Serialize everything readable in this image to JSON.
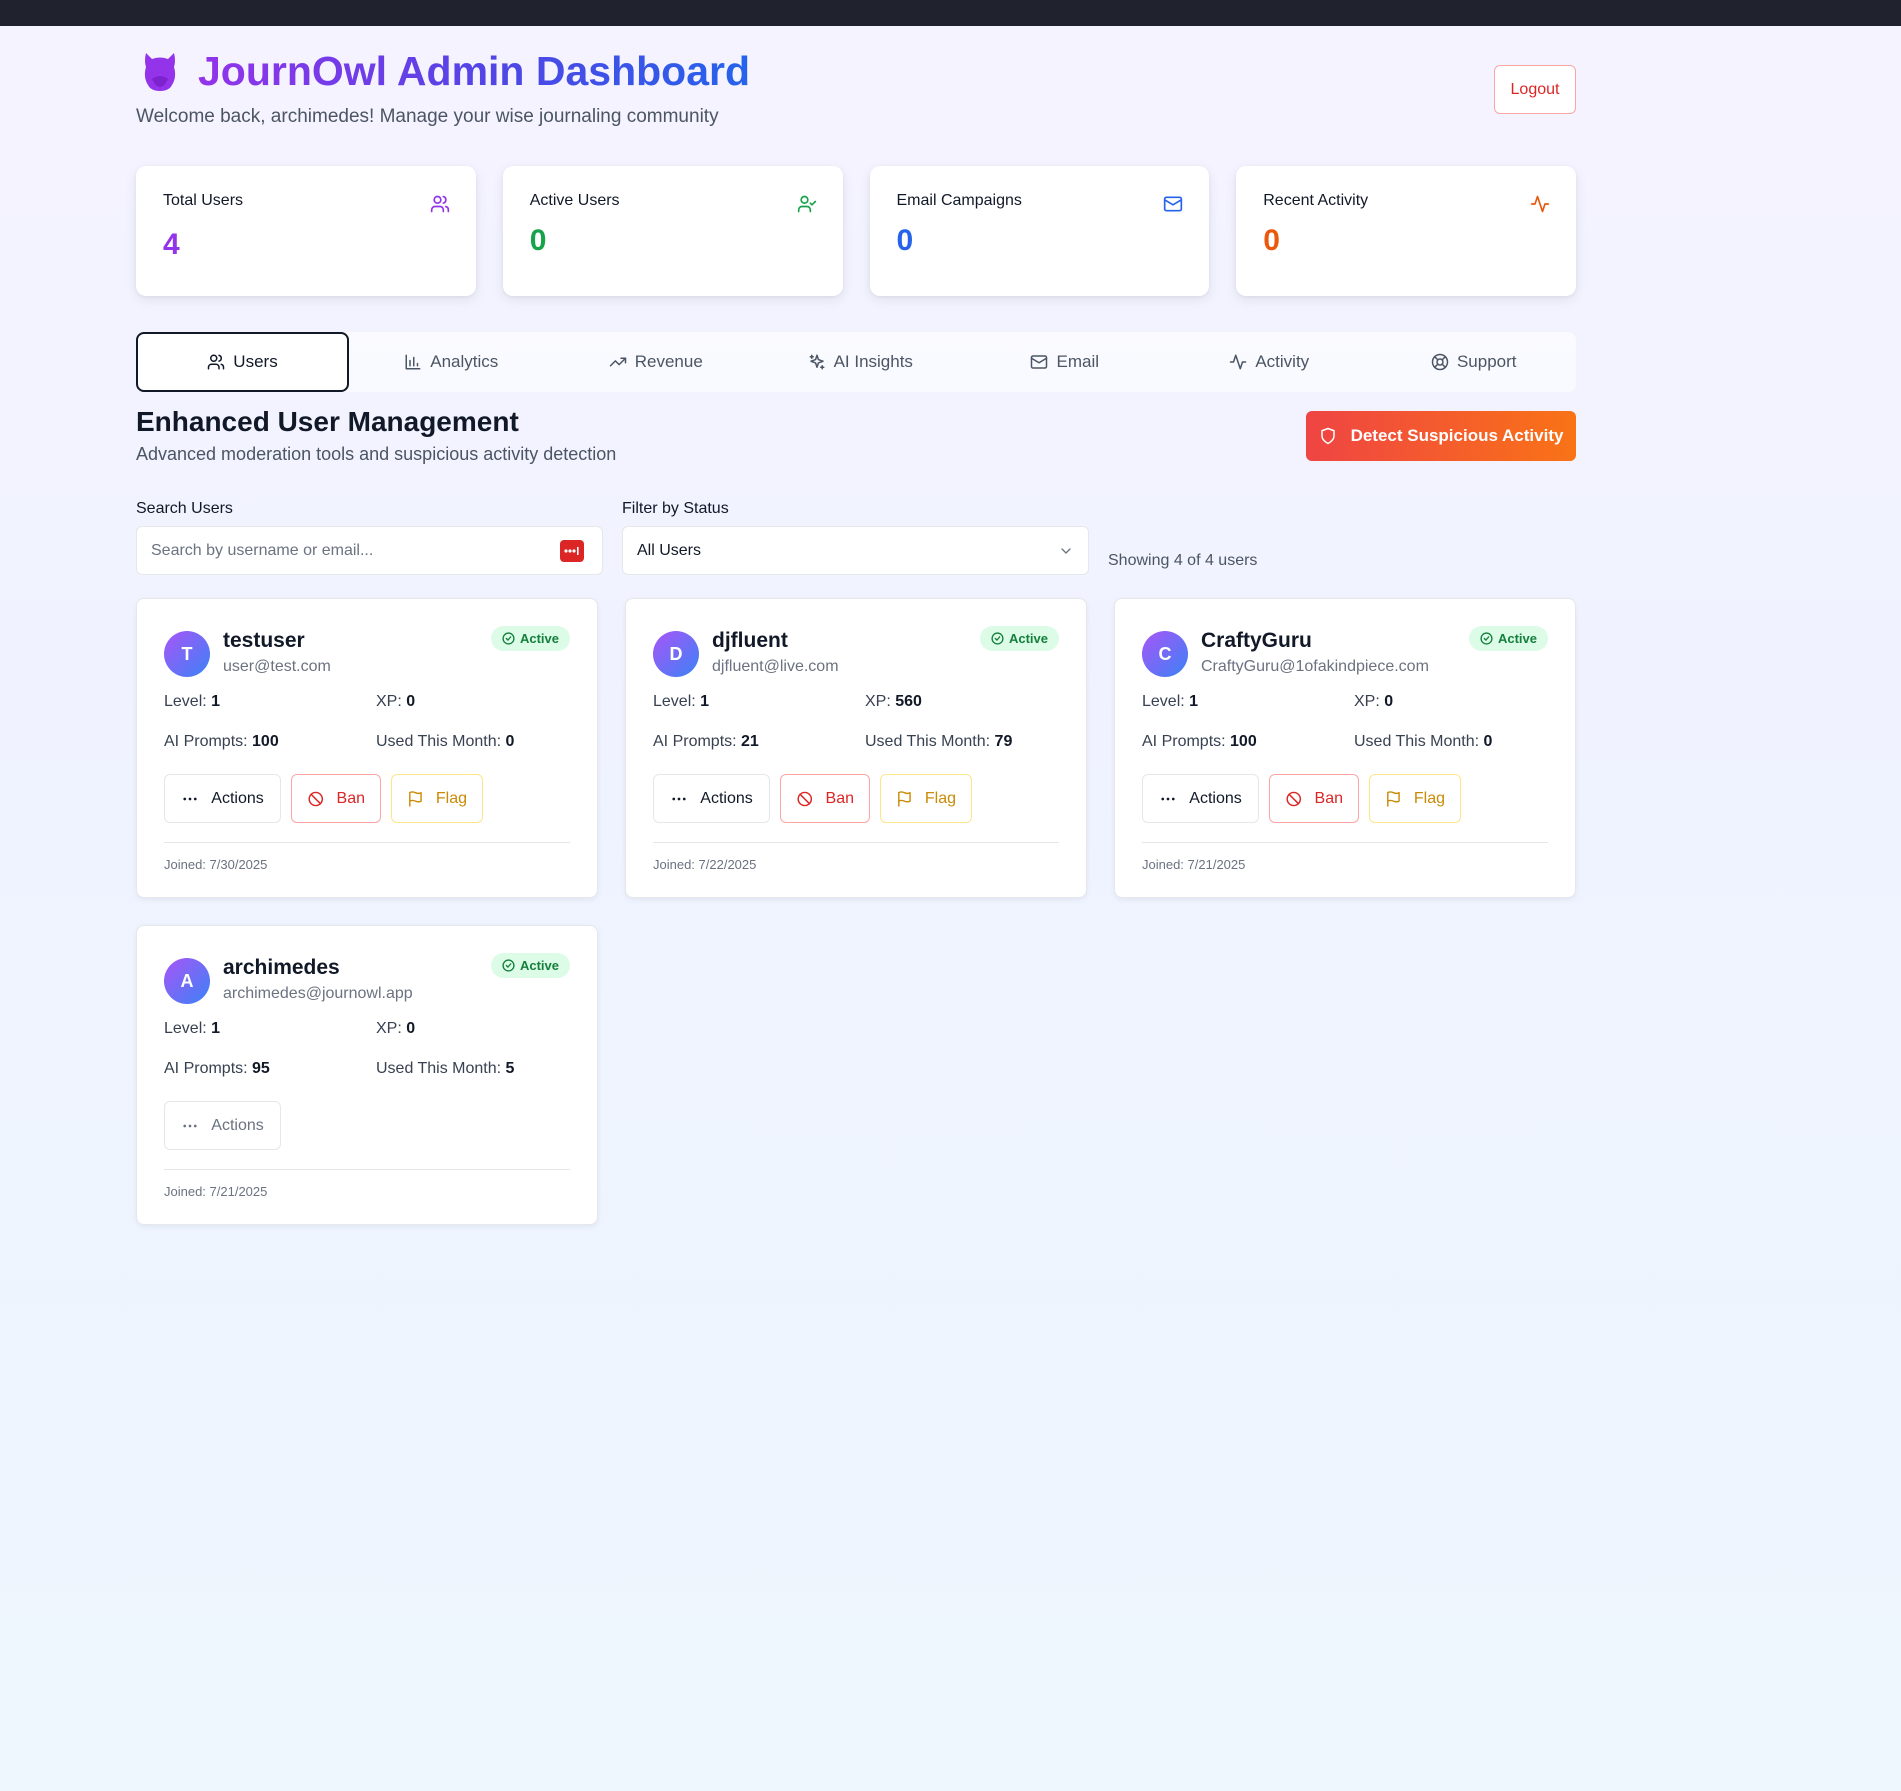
{
  "header": {
    "title": "JournOwl Admin Dashboard",
    "subtitle": "Welcome back, archimedes! Manage your wise journaling community",
    "logout_label": "Logout"
  },
  "stats": [
    {
      "label": "Total Users",
      "value": "4",
      "icon": "users-icon",
      "color": "#9333ea"
    },
    {
      "label": "Active Users",
      "value": "0",
      "icon": "user-check-icon",
      "color": "#16a34a"
    },
    {
      "label": "Email Campaigns",
      "value": "0",
      "icon": "mail-icon",
      "color": "#2563eb"
    },
    {
      "label": "Recent Activity",
      "value": "0",
      "icon": "activity-icon",
      "color": "#ea580c"
    }
  ],
  "tabs": [
    {
      "label": "Users",
      "icon": "users-icon",
      "active": true
    },
    {
      "label": "Analytics",
      "icon": "bar-chart-icon"
    },
    {
      "label": "Revenue",
      "icon": "trending-up-icon"
    },
    {
      "label": "AI Insights",
      "icon": "sparkles-icon"
    },
    {
      "label": "Email",
      "icon": "mail-icon"
    },
    {
      "label": "Activity",
      "icon": "activity-icon"
    },
    {
      "label": "Support",
      "icon": "lifebuoy-icon"
    }
  ],
  "section": {
    "title": "Enhanced User Management",
    "subtitle": "Advanced moderation tools and suspicious activity detection",
    "detect_label": "Detect Suspicious Activity"
  },
  "filters": {
    "search_label": "Search Users",
    "search_placeholder": "Search by username or email...",
    "status_label": "Filter by Status",
    "status_selected": "All Users",
    "showing": "Showing 4 of 4 users"
  },
  "labels": {
    "level": "Level:",
    "xp": "XP:",
    "ai_prompts": "AI Prompts:",
    "used_month": "Used This Month:",
    "actions": "Actions",
    "ban": "Ban",
    "flag": "Flag"
  },
  "users": [
    {
      "initial": "T",
      "username": "testuser",
      "email": "user@test.com",
      "status": "Active",
      "level": "1",
      "xp": "0",
      "ai_prompts": "100",
      "used_month": "0",
      "joined": "Joined: 7/30/2025"
    },
    {
      "initial": "D",
      "username": "djfluent",
      "email": "djfluent@live.com",
      "status": "Active",
      "level": "1",
      "xp": "560",
      "ai_prompts": "21",
      "used_month": "79",
      "joined": "Joined: 7/22/2025"
    },
    {
      "initial": "C",
      "username": "CraftyGuru",
      "email": "CraftyGuru@1ofakindpiece.com",
      "status": "Active",
      "level": "1",
      "xp": "0",
      "ai_prompts": "100",
      "used_month": "0",
      "joined": "Joined: 7/21/2025"
    },
    {
      "initial": "A",
      "username": "archimedes",
      "email": "archimedes@journowl.app",
      "status": "Active",
      "level": "1",
      "xp": "0",
      "ai_prompts": "95",
      "used_month": "5",
      "joined": "Joined: 7/21/2025"
    }
  ],
  "colors": {
    "brand_purple": "#9333ea",
    "brand_blue": "#2563eb",
    "danger": "#dc2626",
    "warning": "#ca8a04",
    "success": "#16a34a"
  }
}
